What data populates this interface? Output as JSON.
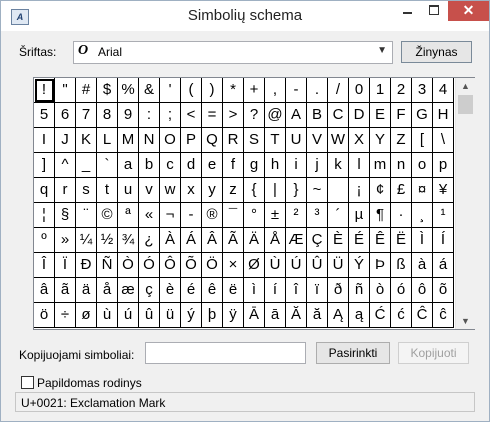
{
  "window": {
    "title": "Simbolių schema",
    "close_label": "✕"
  },
  "font": {
    "label": "Šriftas:",
    "icon": "O",
    "selected": "Arial",
    "help_button": "Žinynas"
  },
  "grid": {
    "rows": [
      [
        "!",
        "\"",
        "#",
        "$",
        "%",
        "&",
        "'",
        "(",
        ")",
        "*",
        "+",
        ",",
        "-",
        ".",
        "/",
        "0",
        "1",
        "2",
        "3",
        "4"
      ],
      [
        "5",
        "6",
        "7",
        "8",
        "9",
        ":",
        ";",
        "<",
        "=",
        ">",
        "?",
        "@",
        "A",
        "B",
        "C",
        "D",
        "E",
        "F",
        "G",
        "H"
      ],
      [
        "I",
        "J",
        "K",
        "L",
        "M",
        "N",
        "O",
        "P",
        "Q",
        "R",
        "S",
        "T",
        "U",
        "V",
        "W",
        "X",
        "Y",
        "Z",
        "[",
        "\\"
      ],
      [
        "]",
        "^",
        "_",
        "`",
        "a",
        "b",
        "c",
        "d",
        "e",
        "f",
        "g",
        "h",
        "i",
        "j",
        "k",
        "l",
        "m",
        "n",
        "o",
        "p"
      ],
      [
        "q",
        "r",
        "s",
        "t",
        "u",
        "v",
        "w",
        "x",
        "y",
        "z",
        "{",
        "|",
        "}",
        "~",
        " ",
        "¡",
        "¢",
        "£",
        "¤",
        "¥"
      ],
      [
        "¦",
        "§",
        "¨",
        "©",
        "ª",
        "«",
        "¬",
        "-",
        "®",
        "¯",
        "°",
        "±",
        "²",
        "³",
        "´",
        "µ",
        "¶",
        "·",
        "¸",
        "¹"
      ],
      [
        "º",
        "»",
        "¼",
        "½",
        "¾",
        "¿",
        "À",
        "Á",
        "Â",
        "Ã",
        "Ä",
        "Å",
        "Æ",
        "Ç",
        "È",
        "É",
        "Ê",
        "Ë",
        "Ì",
        "Í"
      ],
      [
        "Î",
        "Ï",
        "Ð",
        "Ñ",
        "Ò",
        "Ó",
        "Ô",
        "Õ",
        "Ö",
        "×",
        "Ø",
        "Ù",
        "Ú",
        "Û",
        "Ü",
        "Ý",
        "Þ",
        "ß",
        "à",
        "á"
      ],
      [
        "â",
        "ã",
        "ä",
        "å",
        "æ",
        "ç",
        "è",
        "é",
        "ê",
        "ë",
        "ì",
        "í",
        "î",
        "ï",
        "ð",
        "ñ",
        "ò",
        "ó",
        "ô",
        "õ"
      ],
      [
        "ö",
        "÷",
        "ø",
        "ù",
        "ú",
        "û",
        "ü",
        "ý",
        "þ",
        "ÿ",
        "Ā",
        "ā",
        "Ă",
        "ă",
        "Ą",
        "ą",
        "Ć",
        "ć",
        "Ĉ",
        "ĉ"
      ]
    ],
    "selected_index": 0
  },
  "copy": {
    "label": "Kopijuojami simboliai:",
    "value": "",
    "select_button": "Pasirinkti",
    "copy_button": "Kopijuoti"
  },
  "advanced": {
    "label": "Papildomas rodinys",
    "checked": false
  },
  "status": {
    "text": "U+0021: Exclamation Mark"
  },
  "colors": {
    "close_button": "#c7504b",
    "window_bg": "#f0f0f0"
  }
}
